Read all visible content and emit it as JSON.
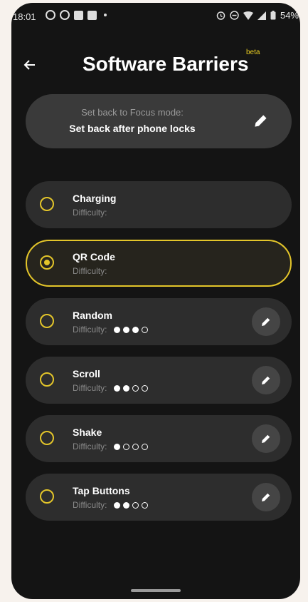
{
  "status_bar": {
    "time": "18:01",
    "battery": "54%"
  },
  "header": {
    "title": "Software Barriers",
    "badge": "beta"
  },
  "focus_card": {
    "subtitle": "Set back to Focus mode:",
    "value": "Set back after phone locks"
  },
  "difficulty_label": "Difficulty:",
  "barriers": [
    {
      "name": "Charging",
      "difficulty_label": "Difficulty:",
      "difficulty": null,
      "selected": false,
      "editable": false
    },
    {
      "name": "QR Code",
      "difficulty_label": "Difficulty:",
      "difficulty": null,
      "selected": true,
      "editable": false
    },
    {
      "name": "Random",
      "difficulty_label": "Difficulty:",
      "difficulty": 3,
      "selected": false,
      "editable": true
    },
    {
      "name": "Scroll",
      "difficulty_label": "Difficulty:",
      "difficulty": 2,
      "selected": false,
      "editable": true
    },
    {
      "name": "Shake",
      "difficulty_label": "Difficulty:",
      "difficulty": 1,
      "selected": false,
      "editable": true
    },
    {
      "name": "Tap Buttons",
      "difficulty_label": "Difficulty:",
      "difficulty": 2,
      "selected": false,
      "editable": true
    }
  ],
  "difficulty_max": 4,
  "colors": {
    "accent": "#e3c52a",
    "card": "#2d2d2d",
    "background": "#141414"
  },
  "icons": {
    "back": "arrow-left-icon",
    "edit": "pencil-icon"
  }
}
